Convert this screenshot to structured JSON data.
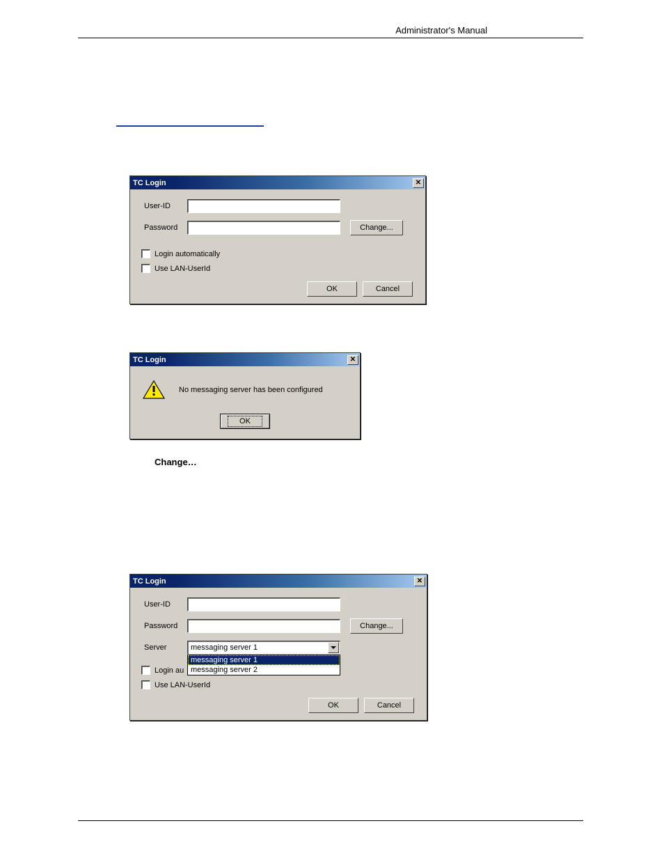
{
  "header": {
    "text": "Administrator's Manual"
  },
  "body_text": {
    "change_label": "Change…"
  },
  "dialog1": {
    "title": "TC Login",
    "labels": {
      "userid": "User-ID",
      "password": "Password"
    },
    "buttons": {
      "change": "Change...",
      "ok": "OK",
      "cancel": "Cancel"
    },
    "checks": {
      "auto": "Login automatically",
      "lan": "Use LAN-UserId"
    },
    "fields": {
      "userid_value": "",
      "password_value": ""
    }
  },
  "dialog2": {
    "title": "TC Login",
    "message": "No messaging server has been configured",
    "buttons": {
      "ok": "OK"
    }
  },
  "dialog3": {
    "title": "TC Login",
    "labels": {
      "userid": "User-ID",
      "password": "Password",
      "server": "Server"
    },
    "buttons": {
      "change": "Change...",
      "ok": "OK",
      "cancel": "Cancel"
    },
    "checks": {
      "auto_partial": "Login au",
      "lan": "Use LAN-UserId"
    },
    "fields": {
      "userid_value": "",
      "password_value": ""
    },
    "server": {
      "selected": "messaging server 1",
      "options": [
        "messaging server 1",
        "messaging server 2"
      ]
    }
  }
}
